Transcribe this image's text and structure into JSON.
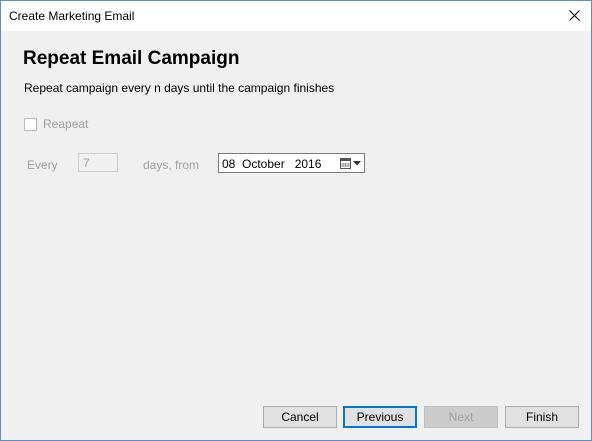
{
  "window": {
    "title": "Create Marketing Email"
  },
  "page": {
    "heading": "Repeat Email Campaign",
    "description": "Repeat campaign every n days until the campaign finishes"
  },
  "repeat": {
    "checkbox_label": "Reapeat",
    "checked": false,
    "enabled": false
  },
  "interval": {
    "every_label": "Every",
    "days_value": "7",
    "days_from_label": "days, from"
  },
  "start_date": {
    "display": "08  October   2016",
    "day": "08",
    "month": "October",
    "year": "2016"
  },
  "buttons": {
    "cancel_label": "Cancel",
    "previous_label": "Previous",
    "next_label": "Next",
    "finish_label": "Finish"
  },
  "colors": {
    "accent": "#0078d7",
    "dialog_background": "#f0f0f0",
    "disabled_text": "#a0a0a0"
  },
  "icons": {
    "close": "close-icon",
    "calendar": "calendar-icon",
    "dropdown": "chevron-down-icon"
  }
}
